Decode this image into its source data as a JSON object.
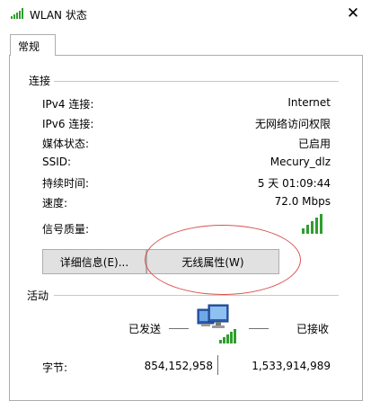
{
  "window": {
    "title": "WLAN 状态",
    "close_glyph": "✕"
  },
  "tabs": [
    {
      "label": "常规",
      "selected": true
    }
  ],
  "connection": {
    "header": "连接",
    "rows": [
      {
        "label": "IPv4 连接:",
        "value": "Internet"
      },
      {
        "label": "IPv6 连接:",
        "value": "无网络访问权限"
      },
      {
        "label": "媒体状态:",
        "value": "已启用"
      },
      {
        "label": "SSID:",
        "value": "Mecury_dlz"
      },
      {
        "label": "持续时间:",
        "value": "5 天 01:09:44"
      },
      {
        "label": "速度:",
        "value": "72.0 Mbps"
      }
    ],
    "signal_label": "信号质量:",
    "signal_bars_filled": 5,
    "signal_bars_total": 5,
    "details_button": "详细信息(E)...",
    "wireless_properties_button": "无线属性(W)"
  },
  "activity": {
    "header": "活动",
    "sent_label": "已发送",
    "received_label": "已接收",
    "bytes_label": "字节:",
    "bytes_sent": "854,152,958",
    "bytes_received": "1,533,914,989"
  },
  "colors": {
    "signal_green": "#2e9e2e",
    "highlight_ellipse": "#d9534f",
    "button_bg": "#e1e1e1"
  }
}
